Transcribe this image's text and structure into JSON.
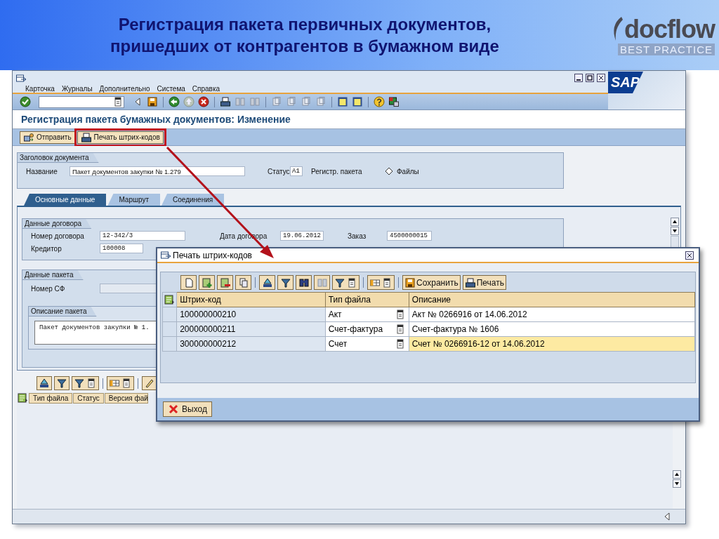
{
  "slide": {
    "title_lines": [
      "Регистрация пакета первичных документов,",
      "пришедших от контрагентов в бумажном виде"
    ],
    "logo": {
      "name": "docflow",
      "tagline": "BEST PRACTICE"
    }
  },
  "window": {
    "menu": [
      "Карточка",
      "Журналы",
      "Дополнительно",
      "Система",
      "Справка"
    ],
    "logo": "SAP",
    "screen_title": "Регистрация пакета бумажных документов: Изменение",
    "app_toolbar": [
      {
        "kind": "send",
        "label": "Отправить",
        "highlighted": false
      },
      {
        "kind": "print",
        "label": "Печать штрих-кодов",
        "highlighted": true
      }
    ]
  },
  "header_group": {
    "title": "Заголовок документа",
    "name_label": "Название",
    "name_value": "Пакет документов закупки № 1.279",
    "status_label": "Статус",
    "status_value": "A1",
    "status_text": "Регистр. пакета",
    "files_label": "Файлы"
  },
  "tabs": [
    {
      "label": "Основные данные",
      "selected": true
    },
    {
      "label": "Маршрут",
      "selected": false
    },
    {
      "label": "Соединения",
      "selected": false
    }
  ],
  "contract_group": {
    "title": "Данные договора",
    "contract_label": "Номер договора",
    "contract_value": "12-342/3",
    "date_label": "Дата договора",
    "date_value": "19.06.2012",
    "order_label": "Заказ",
    "order_value": "4500000015",
    "creditor_label": "Кредитор",
    "creditor_value": "100008"
  },
  "package_group": {
    "title": "Данные пакета",
    "invoice_label": "Номер СФ",
    "description_title": "Описание пакета",
    "description_text": "Пакет документов закупки № 1."
  },
  "files_table": {
    "columns": [
      "Тип файла",
      "Статус",
      "Версия фай"
    ]
  },
  "dialog": {
    "title": "Печать штрих-кодов",
    "buttons": [
      {
        "kind": "save",
        "label": "Сохранить"
      },
      {
        "kind": "print",
        "label": "Печать"
      }
    ],
    "columns": [
      "Штрих-код",
      "Тип файла",
      "Описание"
    ],
    "rows": [
      {
        "barcode": "100000000210",
        "file_type": "Акт",
        "description": "Акт №  0266916 от 14.06.2012",
        "highlighted": false
      },
      {
        "barcode": "200000000211",
        "file_type": "Счет-фактура",
        "description": "Счет-фактура № 1606",
        "highlighted": false
      },
      {
        "barcode": "300000000212",
        "file_type": "Счет",
        "description": "Счет №  0266916-12 от 14.06.2012",
        "highlighted": true
      }
    ],
    "exit_button": "Выход"
  }
}
